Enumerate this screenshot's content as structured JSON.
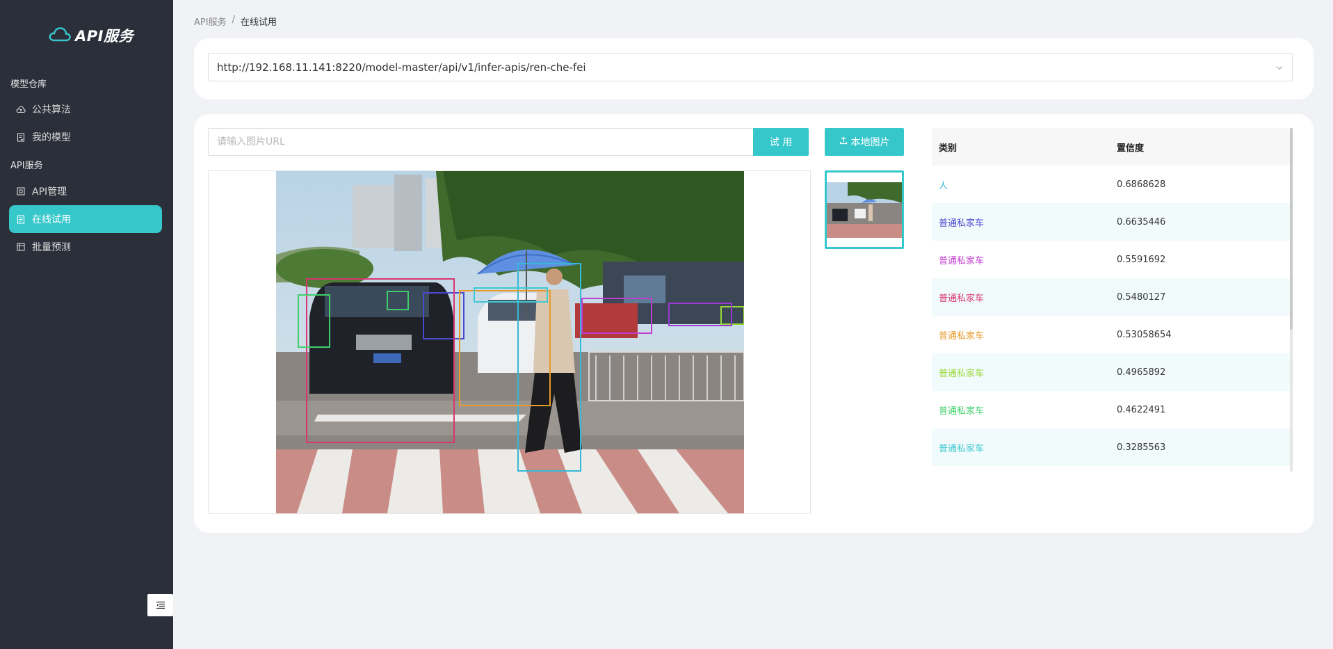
{
  "sidebar": {
    "logo_text": "API服务",
    "groups": [
      {
        "title": "模型仓库"
      },
      {
        "title": "API服务"
      }
    ],
    "items": [
      {
        "label": "公共算法",
        "icon": "cloud-icon"
      },
      {
        "label": "我的模型",
        "icon": "document-icon"
      },
      {
        "label": "API管理",
        "icon": "api-square-icon"
      },
      {
        "label": "在线试用",
        "icon": "document-list-icon",
        "active": true
      },
      {
        "label": "批量预测",
        "icon": "grid-icon"
      }
    ]
  },
  "breadcrumb": {
    "root": "API服务",
    "separator": "/",
    "current": "在线试用"
  },
  "api_select": {
    "value": "http://192.168.11.141:8220/model-master/api/v1/infer-apis/ren-che-fei"
  },
  "image_url_input": {
    "value": "",
    "placeholder": "请输入图片URL"
  },
  "buttons": {
    "try": "试 用",
    "local_image": "本地图片"
  },
  "table": {
    "headers": {
      "category": "类别",
      "confidence": "置信度"
    },
    "rows": [
      {
        "category": "人",
        "confidence": "0.6868628",
        "color": "#36b8d6"
      },
      {
        "category": "普通私家车",
        "confidence": "0.6635446",
        "color": "#4a4ad0"
      },
      {
        "category": "普通私家车",
        "confidence": "0.5591692",
        "color": "#c23ccf"
      },
      {
        "category": "普通私家车",
        "confidence": "0.5480127",
        "color": "#d8366f"
      },
      {
        "category": "普通私家车",
        "confidence": "0.53058654",
        "color": "#e89a2c"
      },
      {
        "category": "普通私家车",
        "confidence": "0.4965892",
        "color": "#9ad83a"
      },
      {
        "category": "普通私家车",
        "confidence": "0.4622491",
        "color": "#3fcf6a"
      },
      {
        "category": "普通私家车",
        "confidence": "0.3285563",
        "color": "#3fc8d2"
      }
    ]
  },
  "colors": {
    "accent": "#36c7cb",
    "sidebar_bg": "#2b2f3a",
    "page_bg": "#f0f2f5"
  }
}
